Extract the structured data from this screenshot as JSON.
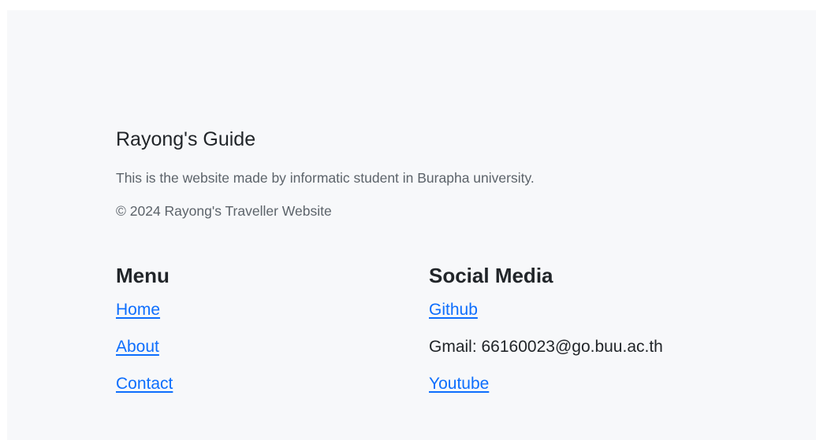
{
  "brand": {
    "title": "Rayong's Guide",
    "description": "This is the website made by informatic student in Burapha university.",
    "copyright": "© 2024 Rayong's Traveller Website"
  },
  "menu": {
    "heading": "Menu",
    "items": [
      {
        "label": "Home"
      },
      {
        "label": "About"
      },
      {
        "label": "Contact"
      }
    ]
  },
  "social": {
    "heading": "Social Media",
    "github_label": "Github",
    "gmail_text": "Gmail: 66160023@go.buu.ac.th",
    "youtube_label": "Youtube"
  },
  "colors": {
    "background": "#f7f8fa",
    "link": "#0d6efd",
    "text": "#212529",
    "muted": "#5c636a"
  }
}
